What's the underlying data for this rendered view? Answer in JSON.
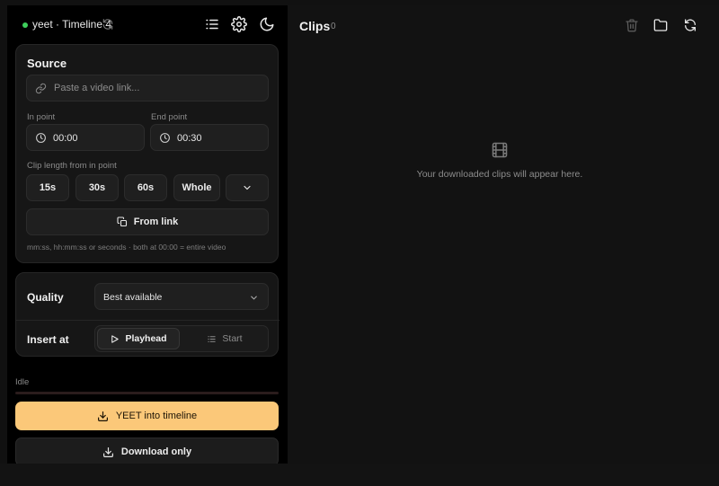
{
  "header": {
    "title": "yeet · Timeline 4"
  },
  "source": {
    "heading": "Source",
    "link_placeholder": "Paste a video link...",
    "in_point_label": "In point",
    "in_point_value": "00:00",
    "end_point_label": "End point",
    "end_point_value": "00:30",
    "clip_length_label": "Clip length from in point",
    "presets": [
      "15s",
      "30s",
      "60s",
      "Whole"
    ],
    "from_link_label": "From link",
    "hint": "mm:ss, hh:mm:ss or seconds · both at 00:00 = entire video"
  },
  "options": {
    "quality_label": "Quality",
    "quality_value": "Best available",
    "insert_label": "Insert at",
    "insert_options": [
      "Playhead",
      "Start"
    ],
    "insert_selected": "Playhead"
  },
  "status": {
    "text": "Idle",
    "progress": 0
  },
  "actions": {
    "primary": "YEET into timeline",
    "secondary": "Download only"
  },
  "clips": {
    "title": "Clips",
    "count": "0",
    "empty_text": "Your downloaded clips will appear here."
  },
  "colors": {
    "accent": "#fbc879",
    "status_dot": "#3ecf5c",
    "background": "#111111",
    "panel": "#161616"
  },
  "icons": {
    "header": [
      "refresh-icon",
      "list-icon",
      "gear-icon",
      "moon-icon"
    ],
    "clips_toolbar": [
      "trash-icon",
      "folder-icon",
      "refresh-icon"
    ],
    "empty_state": "film-icon"
  }
}
